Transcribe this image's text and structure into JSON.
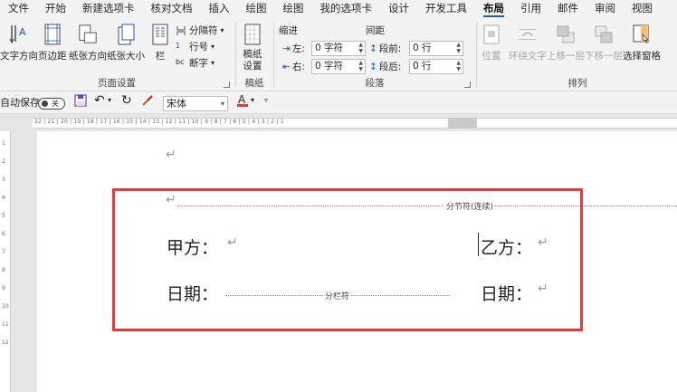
{
  "tabs": [
    "文件",
    "开始",
    "新建选项卡",
    "核对文档",
    "插入",
    "绘图",
    "绘图",
    "我的选项卡",
    "设计",
    "开发工具",
    "布局",
    "引用",
    "邮件",
    "审阅",
    "视图"
  ],
  "ribbon": {
    "page_setup": {
      "label": "页面设置",
      "text_direction": "文字方向",
      "margins": "页边距",
      "orientation": "纸张方向",
      "size": "纸张大小",
      "columns": "栏",
      "breaks": "分隔符",
      "line_numbers": "行号",
      "hyphenation": "断字"
    },
    "draft_paper": {
      "label": "稿纸",
      "settings": "稿纸\n设置"
    },
    "paragraph": {
      "label": "段落",
      "indent": "缩进",
      "spacing": "间距",
      "left_label": "左:",
      "right_label": "右:",
      "before_label": "段前:",
      "after_label": "段后:",
      "left_value": "0 字符",
      "right_value": "0 字符",
      "before_value": "0 行",
      "after_value": "0 行"
    },
    "arrange": {
      "label": "排列",
      "position": "位置",
      "wrap_text": "环绕文字",
      "bring_forward": "上移一层",
      "send_backward": "下移一层",
      "selection_pane": "选择窗格"
    }
  },
  "qat": {
    "autosave": "自动保存",
    "toggle_state": "关",
    "font": "宋体"
  },
  "ruler": {
    "h_numbers": "22 | 21 | 20 | 19 | 18 | 17 | 16 | 15 | 14 | 13 | 12 | 11 | 10 | 9 | 8 | 7 | 6 | 5 | 4 | 3 | 2 | 1",
    "v_numbers": "1 2 3 4 5 6 7 8 9 10 11 12"
  },
  "document": {
    "para_mark": "↵",
    "section_break": "分节符(连续)",
    "column_break": "分栏符",
    "party_a": "甲方：",
    "party_b": "乙方：",
    "date_left": "日期：",
    "date_right": "日期："
  },
  "colors": {
    "accent": "#185abd",
    "highlight_border": "#e23b3b",
    "font_color": "#e23b3b"
  }
}
